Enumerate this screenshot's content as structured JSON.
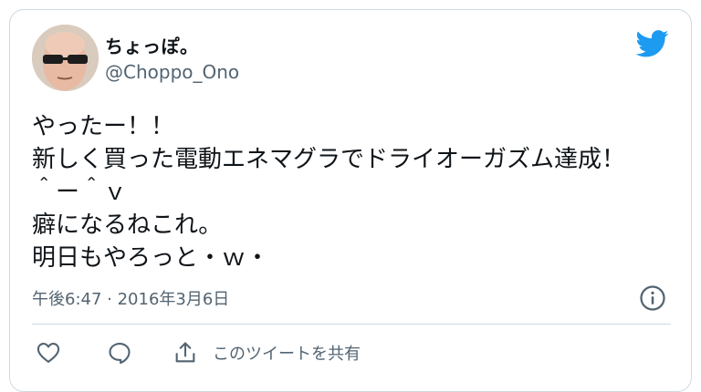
{
  "user": {
    "display_name": "ちょっぽ。",
    "handle": "@Choppo_Ono"
  },
  "tweet": {
    "lines": [
      "やったー！！",
      "新しく買った電動エネマグラでドライオーガズム達成！",
      "＾ー＾ｖ",
      "癖になるねこれ。",
      "明日もやろっと・ｗ・"
    ],
    "timestamp": "午後6:47 · 2016年3月6日"
  },
  "actions": {
    "share_label": "このツイートを共有"
  },
  "icons": {
    "brand": "twitter-bird-icon",
    "info": "info-icon",
    "like": "heart-icon",
    "reply": "speech-bubble-icon",
    "share": "share-icon"
  },
  "colors": {
    "brand": "#1d9bf0",
    "text": "#0f1419",
    "secondary": "#536471",
    "border": "#cfd9de"
  }
}
